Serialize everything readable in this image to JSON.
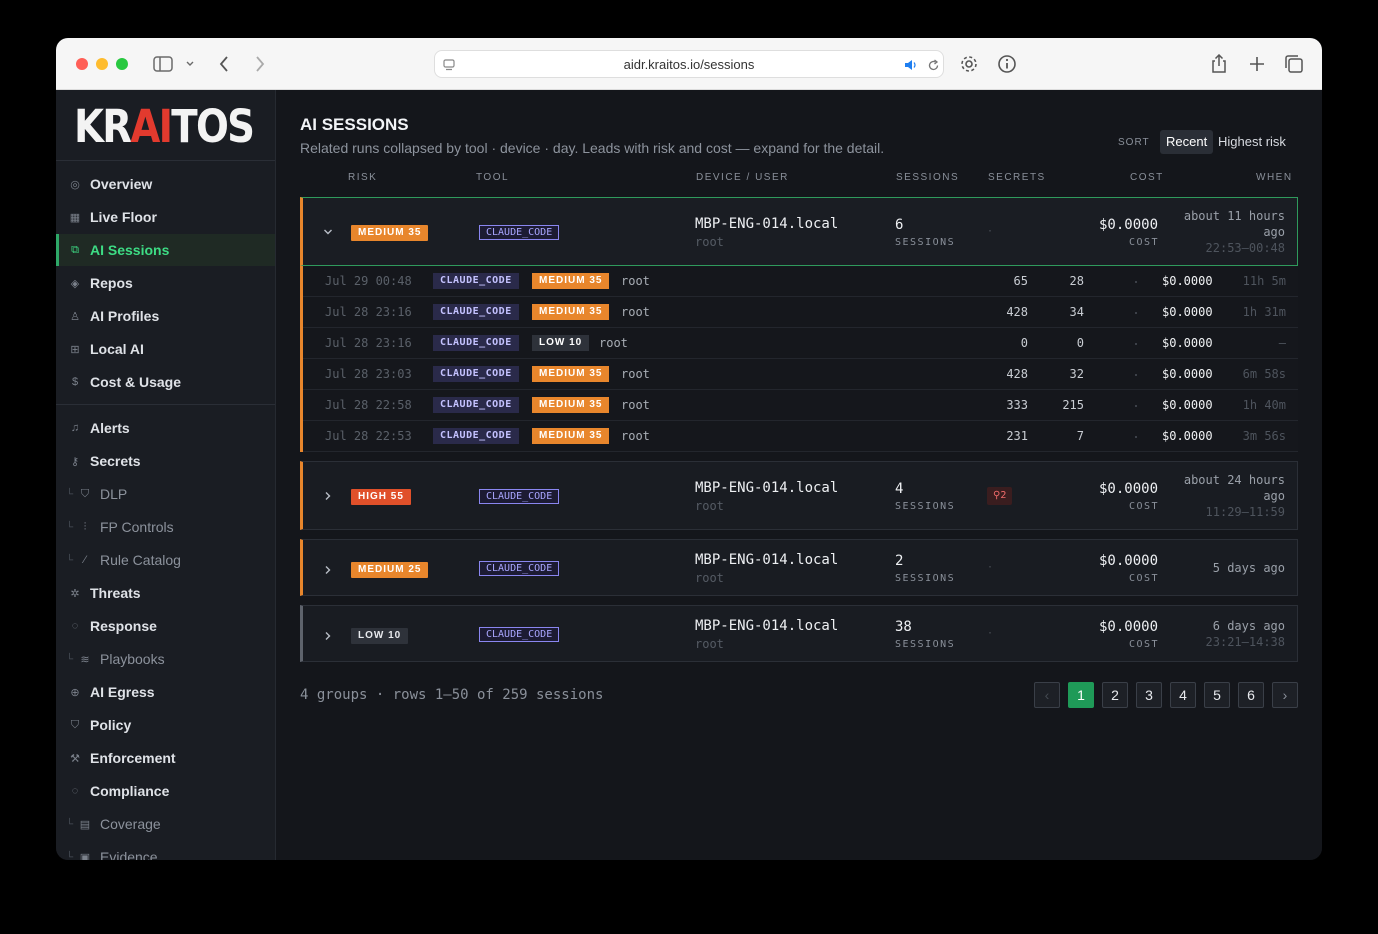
{
  "browser": {
    "url": "aidr.kraitos.io/sessions"
  },
  "brand": {
    "logo_prefix": "KR",
    "logo_ai": "AI",
    "logo_suffix": "TOS",
    "accent": "#3ddc84",
    "logo_accent": "#e23a2e"
  },
  "sidebar": {
    "items": [
      {
        "label": "Overview",
        "icon": "overview-icon"
      },
      {
        "label": "Live Floor",
        "icon": "grid-icon"
      },
      {
        "label": "AI Sessions",
        "icon": "sessions-icon",
        "active": true
      },
      {
        "label": "Repos",
        "icon": "repo-icon"
      },
      {
        "label": "AI Profiles",
        "icon": "profile-icon"
      },
      {
        "label": "Local AI",
        "icon": "chip-icon"
      },
      {
        "label": "Cost & Usage",
        "icon": "dollar-icon"
      },
      {
        "label": "Alerts",
        "icon": "bell-icon"
      },
      {
        "label": "Secrets",
        "icon": "key-icon"
      },
      {
        "label": "DLP",
        "icon": "shield-icon",
        "sub": true
      },
      {
        "label": "FP Controls",
        "icon": "sliders-icon",
        "sub": true
      },
      {
        "label": "Rule Catalog",
        "icon": "rule-icon",
        "sub": true
      },
      {
        "label": "Threats",
        "icon": "bug-icon"
      },
      {
        "label": "Response",
        "icon": "response-icon"
      },
      {
        "label": "Playbooks",
        "icon": "playbook-icon",
        "sub": true
      },
      {
        "label": "AI Egress",
        "icon": "globe-icon"
      },
      {
        "label": "Policy",
        "icon": "policy-icon"
      },
      {
        "label": "Enforcement",
        "icon": "gavel-icon"
      },
      {
        "label": "Compliance",
        "icon": "compliance-icon"
      },
      {
        "label": "Coverage",
        "icon": "clipboard-icon",
        "sub": true
      },
      {
        "label": "Evidence",
        "icon": "evidence-icon",
        "sub": true
      }
    ]
  },
  "main": {
    "title": "AI SESSIONS",
    "subtitle": "Related runs collapsed by tool · device · day. Leads with risk and cost — expand for the detail.",
    "sort": {
      "label": "SORT",
      "options": [
        "Recent",
        "Highest risk"
      ],
      "selected": "Recent"
    },
    "columns": [
      "RISK",
      "TOOL",
      "DEVICE / USER",
      "SESSIONS",
      "SECRETS",
      "COST",
      "WHEN"
    ],
    "groups": [
      {
        "risk": "MEDIUM 35",
        "tool": "CLAUDE_CODE",
        "device": "MBP-ENG-014.local",
        "user": "root",
        "sessions": "6",
        "sessions_label": "SESSIONS",
        "secrets": "·",
        "cost": "$0.0000",
        "cost_label": "COST",
        "when_1": "about 11 hours",
        "when_2": "ago",
        "range": "22:53–00:48",
        "expanded": true
      },
      {
        "risk": "HIGH 55",
        "tool": "CLAUDE_CODE",
        "device": "MBP-ENG-014.local",
        "user": "root",
        "sessions": "4",
        "sessions_label": "SESSIONS",
        "secrets": "2",
        "cost": "$0.0000",
        "cost_label": "COST",
        "when_1": "about 24 hours",
        "when_2": "ago",
        "range": "11:29–11:59"
      },
      {
        "risk": "MEDIUM 25",
        "tool": "CLAUDE_CODE",
        "device": "MBP-ENG-014.local",
        "user": "root",
        "sessions": "2",
        "sessions_label": "SESSIONS",
        "secrets": "·",
        "cost": "$0.0000",
        "cost_label": "COST",
        "when_1": "5 days ago"
      },
      {
        "risk": "LOW 10",
        "tool": "CLAUDE_CODE",
        "device": "MBP-ENG-014.local",
        "user": "root",
        "sessions": "38",
        "sessions_label": "SESSIONS",
        "secrets": "·",
        "cost": "$0.0000",
        "cost_label": "COST",
        "when_1": "6 days ago",
        "range": "23:21–14:38"
      }
    ],
    "sessions": [
      {
        "time": "Jul 29 00:48",
        "tool": "CLAUDE_CODE",
        "risk": "MEDIUM 35",
        "user": "root",
        "a": "65",
        "b": "28",
        "cost": "$0.0000",
        "ago": "11h 5m"
      },
      {
        "time": "Jul 28 23:16",
        "tool": "CLAUDE_CODE",
        "risk": "MEDIUM 35",
        "user": "root",
        "a": "428",
        "b": "34",
        "cost": "$0.0000",
        "ago": "1h 31m"
      },
      {
        "time": "Jul 28 23:16",
        "tool": "CLAUDE_CODE",
        "risk": "LOW 10",
        "user": "root",
        "a": "0",
        "b": "0",
        "cost": "$0.0000",
        "ago": "–"
      },
      {
        "time": "Jul 28 23:03",
        "tool": "CLAUDE_CODE",
        "risk": "MEDIUM 35",
        "user": "root",
        "a": "428",
        "b": "32",
        "cost": "$0.0000",
        "ago": "6m 58s"
      },
      {
        "time": "Jul 28 22:58",
        "tool": "CLAUDE_CODE",
        "risk": "MEDIUM 35",
        "user": "root",
        "a": "333",
        "b": "215",
        "cost": "$0.0000",
        "ago": "1h 40m"
      },
      {
        "time": "Jul 28 22:53",
        "tool": "CLAUDE_CODE",
        "risk": "MEDIUM 35",
        "user": "root",
        "a": "231",
        "b": "7",
        "cost": "$0.0000",
        "ago": "3m 56s"
      }
    ],
    "footer": "4 groups · rows 1–50 of 259 sessions",
    "pagination": {
      "pages": [
        "1",
        "2",
        "3",
        "4",
        "5",
        "6"
      ],
      "current": "1",
      "prev": "‹",
      "next": "›"
    }
  }
}
